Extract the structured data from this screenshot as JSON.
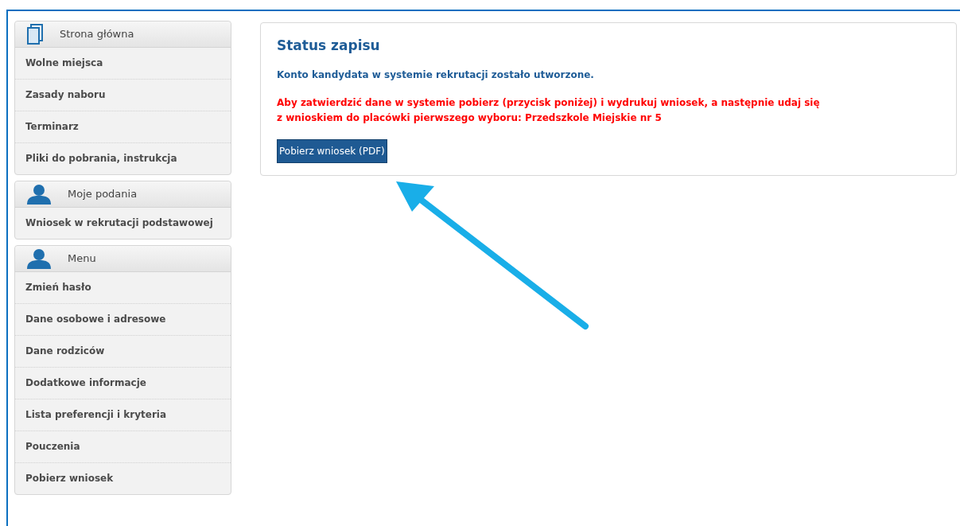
{
  "sidebar": [
    {
      "title": "Strona główna",
      "kind": "document",
      "items": [
        "Wolne miejsca",
        "Zasady naboru",
        "Terminarz",
        "Pliki do pobrania, instrukcja"
      ]
    },
    {
      "title": "Moje podania",
      "kind": "user",
      "items": [
        "Wniosek w rekrutacji podstawowej"
      ]
    },
    {
      "title": "Menu",
      "kind": "user",
      "items": [
        "Zmień hasło",
        "Dane osobowe i adresowe",
        "Dane rodziców",
        "Dodatkowe informacje",
        "Lista preferencji i kryteria",
        "Pouczenia",
        "Pobierz wniosek"
      ]
    }
  ],
  "status": {
    "title": "Status zapisu",
    "message": "Konto kandydata w systemie rekrutacji zostało utworzone.",
    "warning_lines": [
      "Aby zatwierdzić dane w systemie pobierz (przycisk poniżej) i wydrukuj wniosek, a następnie udaj się",
      "z wnioskiem do placówki pierwszego wyboru: Przedszkole Miejskie nr 5"
    ],
    "button": "Pobierz wniosek (PDF)"
  }
}
